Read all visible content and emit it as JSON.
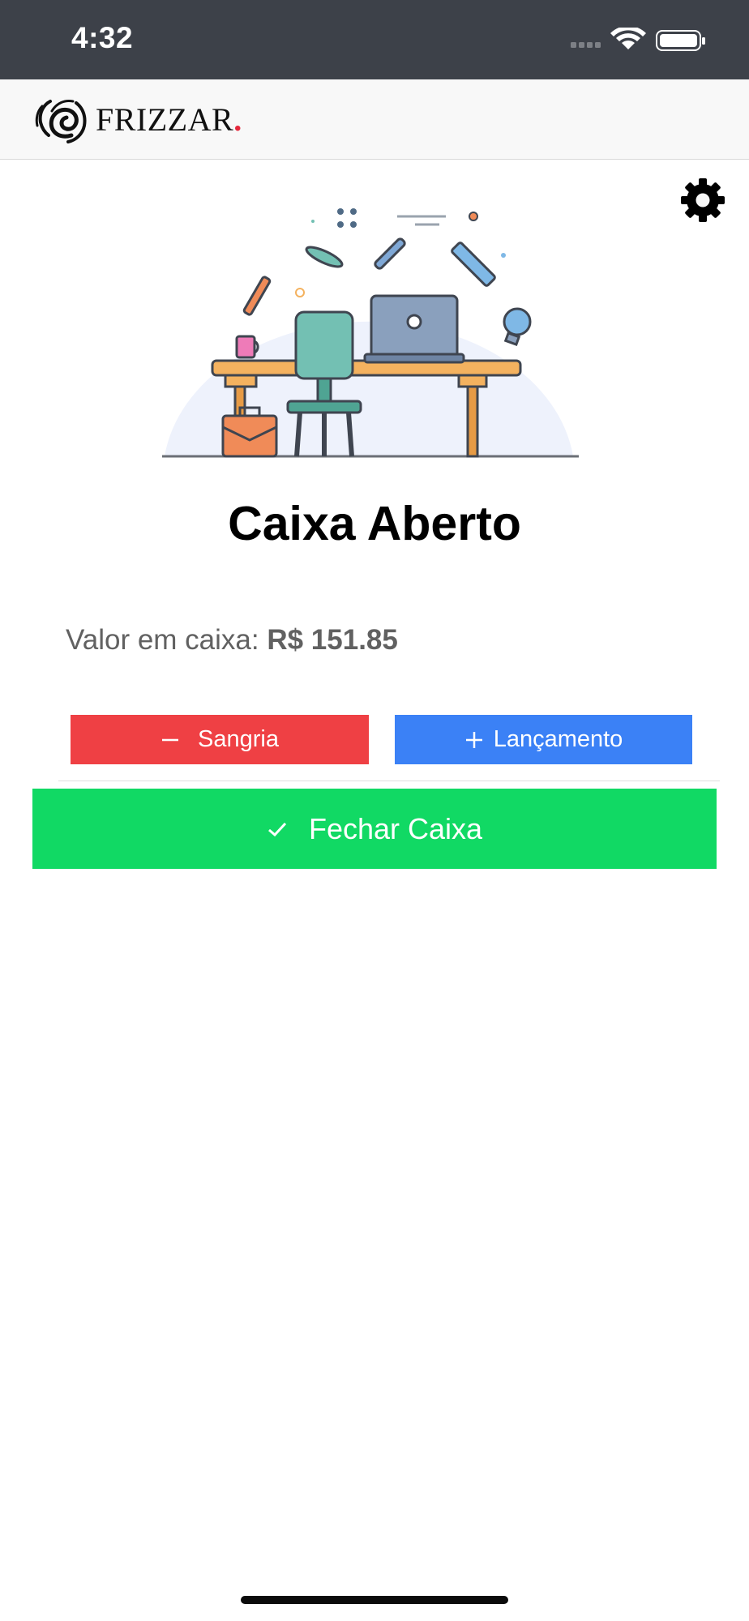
{
  "status_bar": {
    "time": "4:32",
    "icons": [
      "signal-icon",
      "wifi-icon",
      "battery-icon"
    ]
  },
  "header": {
    "brand": "FRIZZAR",
    "brand_dot": ".",
    "settings_icon": "gear-icon"
  },
  "main": {
    "illustration": "workspace-illustration",
    "title": "Caixa Aberto",
    "balance_label": "Valor em caixa:",
    "balance_value": "R$ 151.85",
    "sangria_label": "Sangria",
    "lancamento_label": "Lançamento",
    "fechar_label": "Fechar Caixa"
  },
  "colors": {
    "status_bar": "#3d4149",
    "sangria": "#ef4044",
    "lancamento": "#3b81f6",
    "fechar": "#11d964",
    "brand_dot": "#e5283c"
  }
}
